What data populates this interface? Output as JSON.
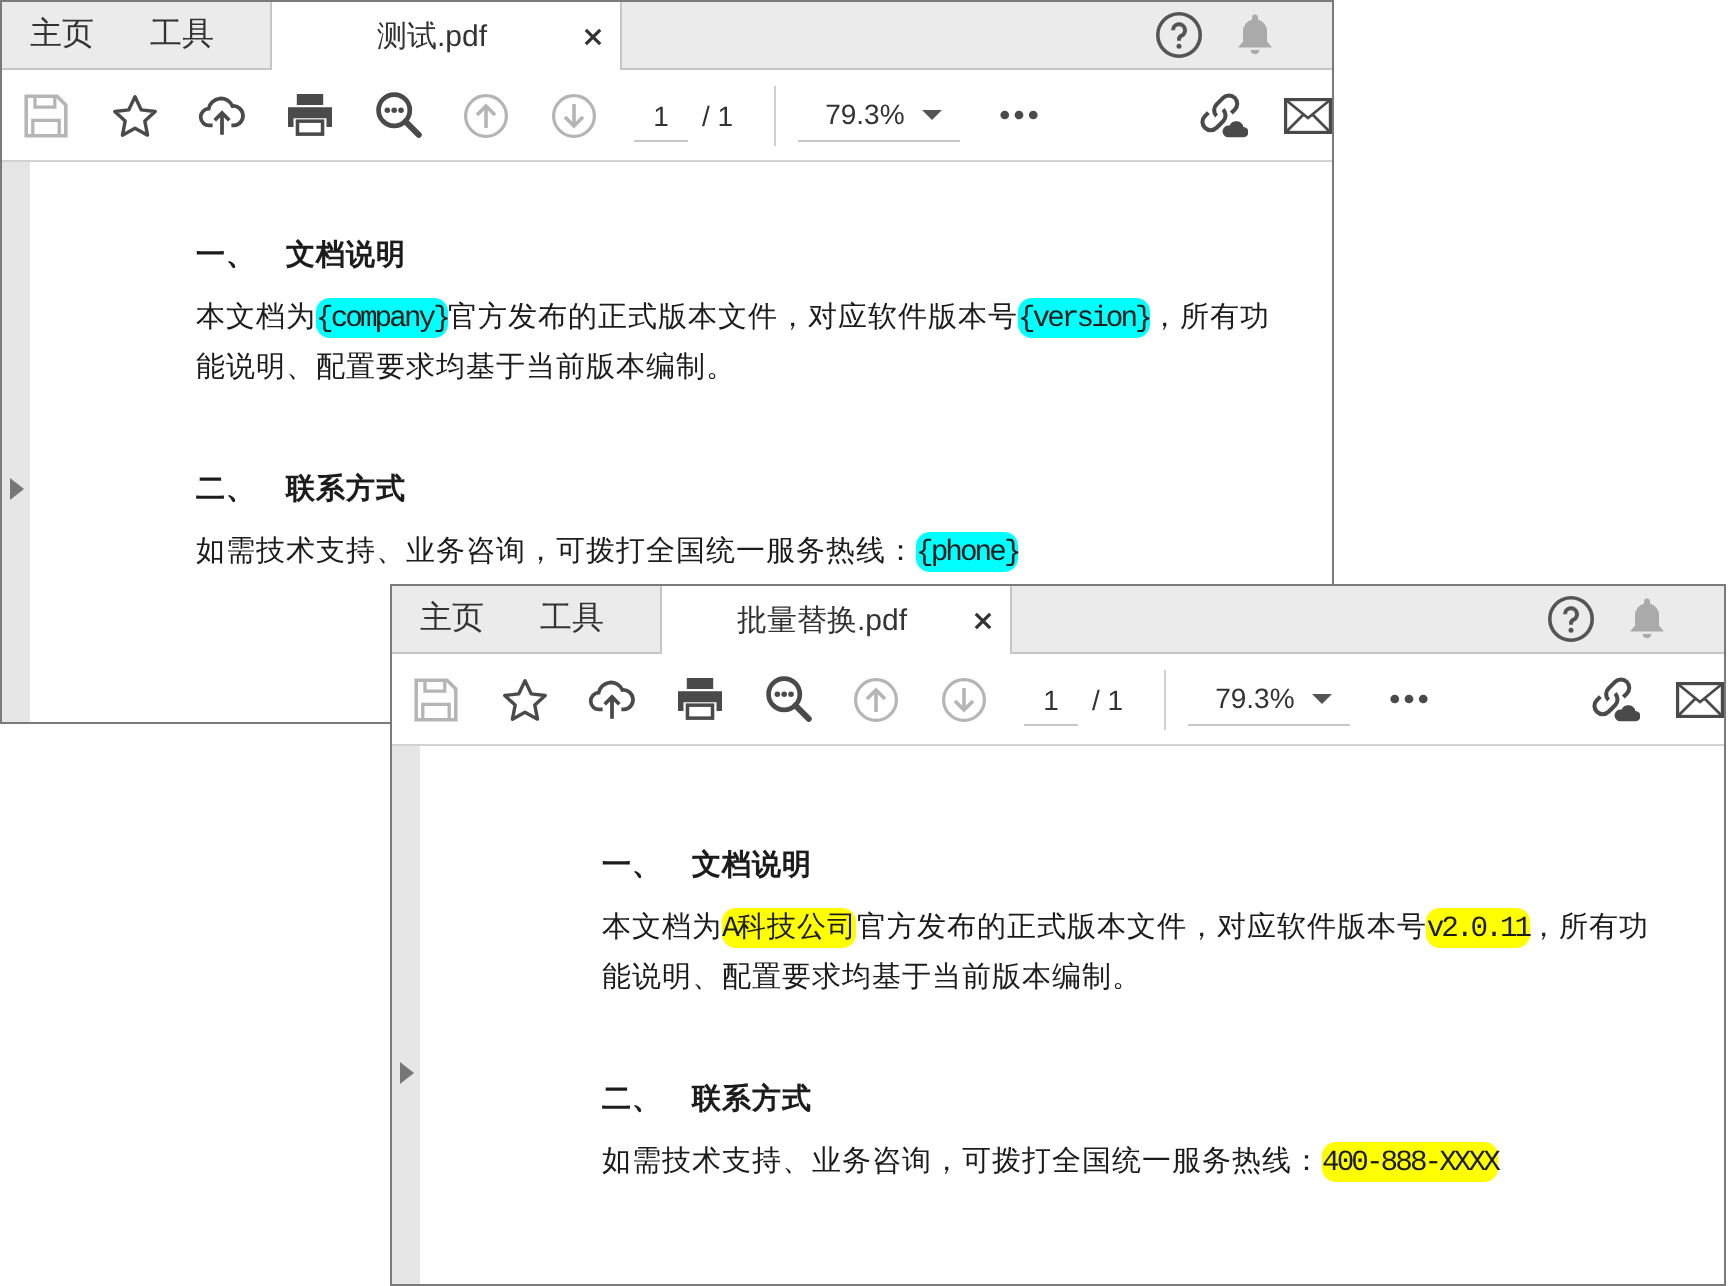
{
  "windows": [
    {
      "tabs": [
        {
          "label": "主页",
          "kind": "nav",
          "selected": false
        },
        {
          "label": "工具",
          "kind": "nav",
          "selected": false
        },
        {
          "label": "测试.pdf",
          "kind": "document",
          "selected": true
        }
      ],
      "toolbar": {
        "tools": [
          {
            "kind": "save",
            "disabled": true
          },
          {
            "kind": "bookmark",
            "disabled": false
          },
          {
            "kind": "upload",
            "disabled": false
          },
          {
            "kind": "print",
            "disabled": false
          },
          {
            "kind": "find",
            "disabled": false
          },
          {
            "kind": "previous_page",
            "disabled": true
          },
          {
            "kind": "next_page",
            "disabled": true
          }
        ],
        "page": {
          "current": "1",
          "total": "/ 1"
        },
        "zoom": {
          "value": "79.3%"
        }
      },
      "document": {
        "sections": [
          {
            "number": "一、",
            "title": "文档说明",
            "paragraph": [
              {
                "text": "本文档为",
                "highlighted": false
              },
              {
                "text": "{company}",
                "highlighted": true,
                "color": "#00ffff"
              },
              {
                "text": "官方发布的正式版本文件，对应软件版本号",
                "highlighted": false
              },
              {
                "text": "{version}",
                "highlighted": true,
                "color": "#00ffff"
              },
              {
                "text": "，所有功能说明、配置要求均基于当前版本编制。",
                "highlighted": false
              }
            ]
          },
          {
            "number": "二、",
            "title": "联系方式",
            "paragraph": [
              {
                "text": "如需技术支持、业务咨询，可拨打全国统一服务热线：",
                "highlighted": false
              },
              {
                "text": "{phone}",
                "highlighted": true,
                "color": "#00ffff"
              }
            ]
          }
        ]
      }
    },
    {
      "tabs": [
        {
          "label": "主页",
          "kind": "nav",
          "selected": false
        },
        {
          "label": "工具",
          "kind": "nav",
          "selected": false
        },
        {
          "label": "批量替换.pdf",
          "kind": "document",
          "selected": true
        }
      ],
      "toolbar": {
        "tools": [
          {
            "kind": "save",
            "disabled": true
          },
          {
            "kind": "bookmark",
            "disabled": false
          },
          {
            "kind": "upload",
            "disabled": false
          },
          {
            "kind": "print",
            "disabled": false
          },
          {
            "kind": "find",
            "disabled": false
          },
          {
            "kind": "previous_page",
            "disabled": true
          },
          {
            "kind": "next_page",
            "disabled": true
          }
        ],
        "page": {
          "current": "1",
          "total": "/ 1"
        },
        "zoom": {
          "value": "79.3%"
        }
      },
      "document": {
        "sections": [
          {
            "number": "一、",
            "title": "文档说明",
            "paragraph": [
              {
                "text": "本文档为",
                "highlighted": false
              },
              {
                "text": "A科技公司",
                "highlighted": true,
                "color": "#ffff00"
              },
              {
                "text": "官方发布的正式版本文件，对应软件版本号",
                "highlighted": false
              },
              {
                "text": "v2.0.11",
                "highlighted": true,
                "color": "#ffff00"
              },
              {
                "text": "，所有功能说明、配置要求均基于当前版本编制。",
                "highlighted": false
              }
            ]
          },
          {
            "number": "二、",
            "title": "联系方式",
            "paragraph": [
              {
                "text": "如需技术支持、业务咨询，可拨打全国统一服务热线：",
                "highlighted": false
              },
              {
                "text": "400-888-XXXX",
                "highlighted": true,
                "color": "#ffff00"
              }
            ]
          }
        ]
      }
    }
  ]
}
